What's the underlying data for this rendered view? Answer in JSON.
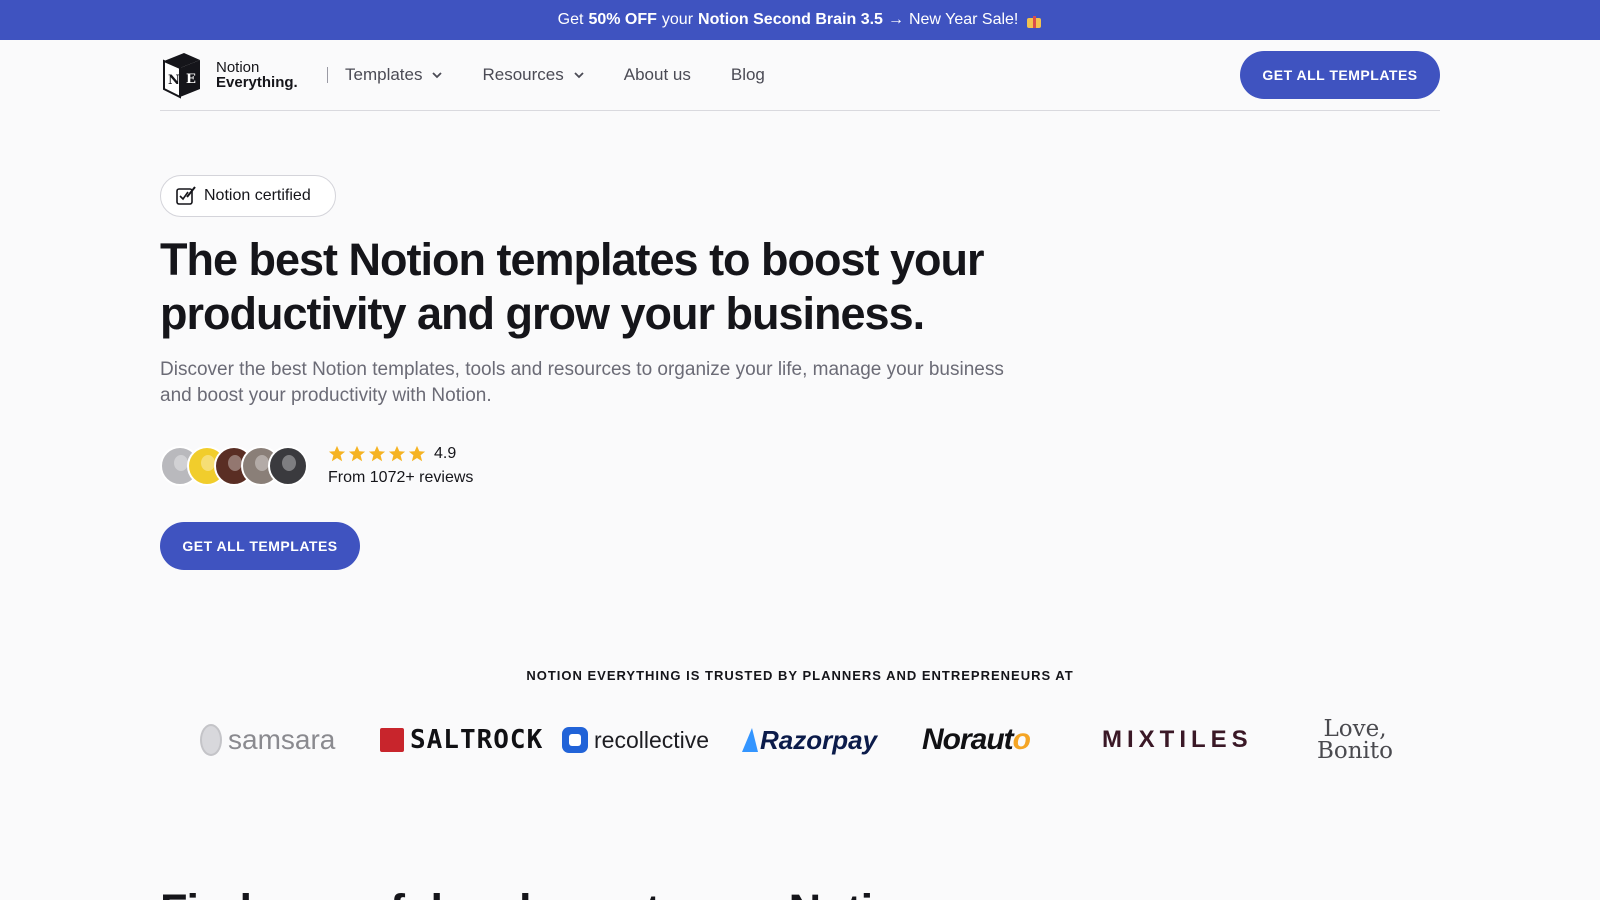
{
  "promo": {
    "pre": "Get",
    "discount": "50% OFF",
    "your": "your",
    "product": "Notion Second Brain 3.5",
    "arrow": "→",
    "sale": "New Year Sale!"
  },
  "header": {
    "logo_mark_left": "N",
    "logo_mark_right": "E",
    "logo_line1": "Notion",
    "logo_line2": "Everything.",
    "nav": [
      {
        "label": "Templates",
        "dropdown": true
      },
      {
        "label": "Resources",
        "dropdown": true
      },
      {
        "label": "About us",
        "dropdown": false
      },
      {
        "label": "Blog",
        "dropdown": false
      }
    ],
    "cta_label": "GET ALL TEMPLATES"
  },
  "hero": {
    "badge_label": "Notion certified",
    "title": "The best Notion templates to boost your productivity and grow your business.",
    "subtitle": "Discover the best Notion templates, tools and resources to organize your life, manage your business and boost your productivity with Notion.",
    "rating_value": "4.9",
    "rating_stars": 5,
    "rating_count": "From 1072+ reviews",
    "cta_label": "GET ALL TEMPLATES"
  },
  "trusted": {
    "title": "NOTION EVERYTHING IS TRUSTED BY PLANNERS AND ENTREPRENEURS AT",
    "brands": [
      "samsara",
      "SALTROCK",
      "recollective",
      "Razorpay",
      "Norauto",
      "MIXTILES",
      "Love, Bonito"
    ]
  },
  "next_section": {
    "title": "Find powerful and smart ways Notion"
  },
  "colors": {
    "accent": "#3f53c0",
    "star": "#f5b323",
    "text": "#15151a",
    "muted": "#6b6b76"
  }
}
